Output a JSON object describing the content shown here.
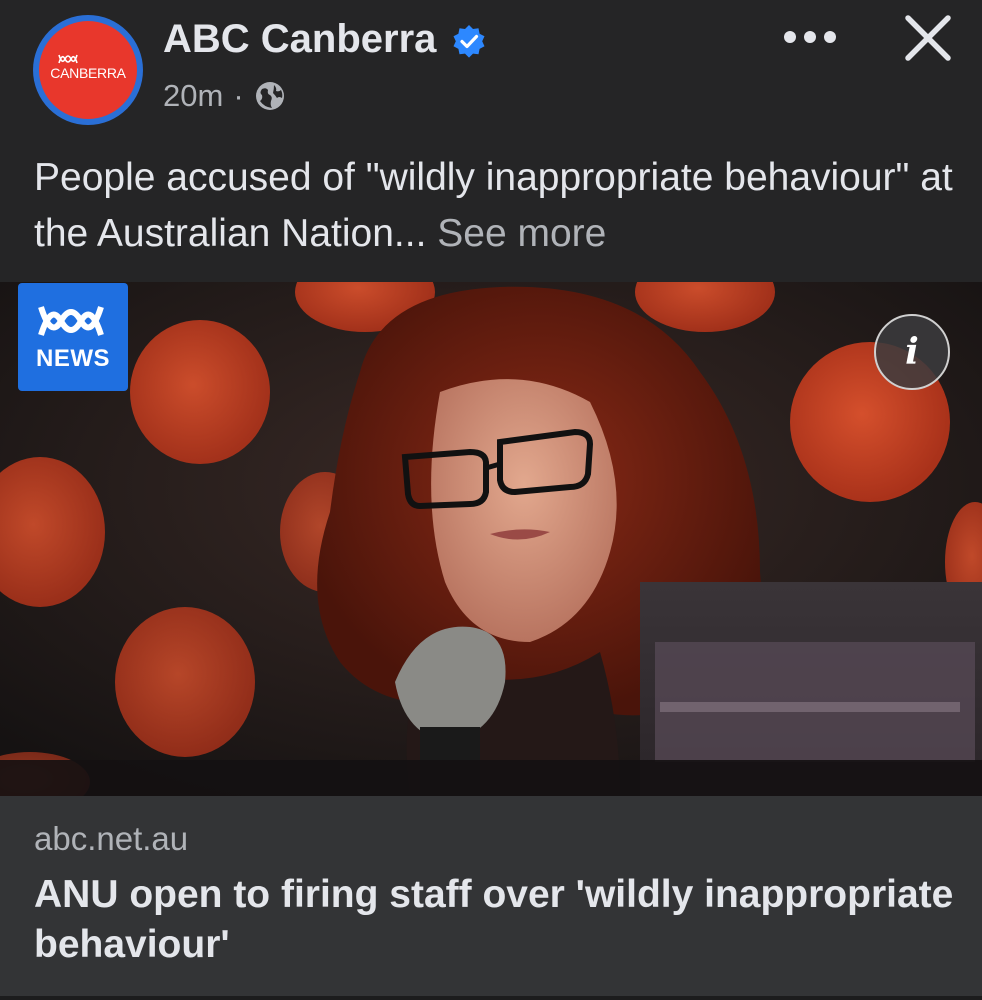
{
  "post": {
    "page_name": "ABC Canberra",
    "avatar_label": "CANBERRA",
    "time": "20m",
    "separator": "·",
    "privacy_icon": "globe-icon",
    "verified_icon": "verified-badge-icon",
    "text": "People accused of \"wildly inappropriate behaviour\" at the Australian Nation...",
    "see_more": "See more"
  },
  "actions": {
    "more_icon": "more-options-icon",
    "close_icon": "close-icon"
  },
  "image": {
    "badge_text": "NEWS",
    "info_label": "i"
  },
  "link": {
    "domain": "abc.net.au",
    "title": "ANU open to firing staff over 'wildly inappropriate behaviour'"
  },
  "colors": {
    "background": "#252526",
    "link_box": "#333436",
    "verified": "#2d88ff",
    "abc_red": "#e8372c",
    "abc_blue": "#1f6fe0"
  }
}
